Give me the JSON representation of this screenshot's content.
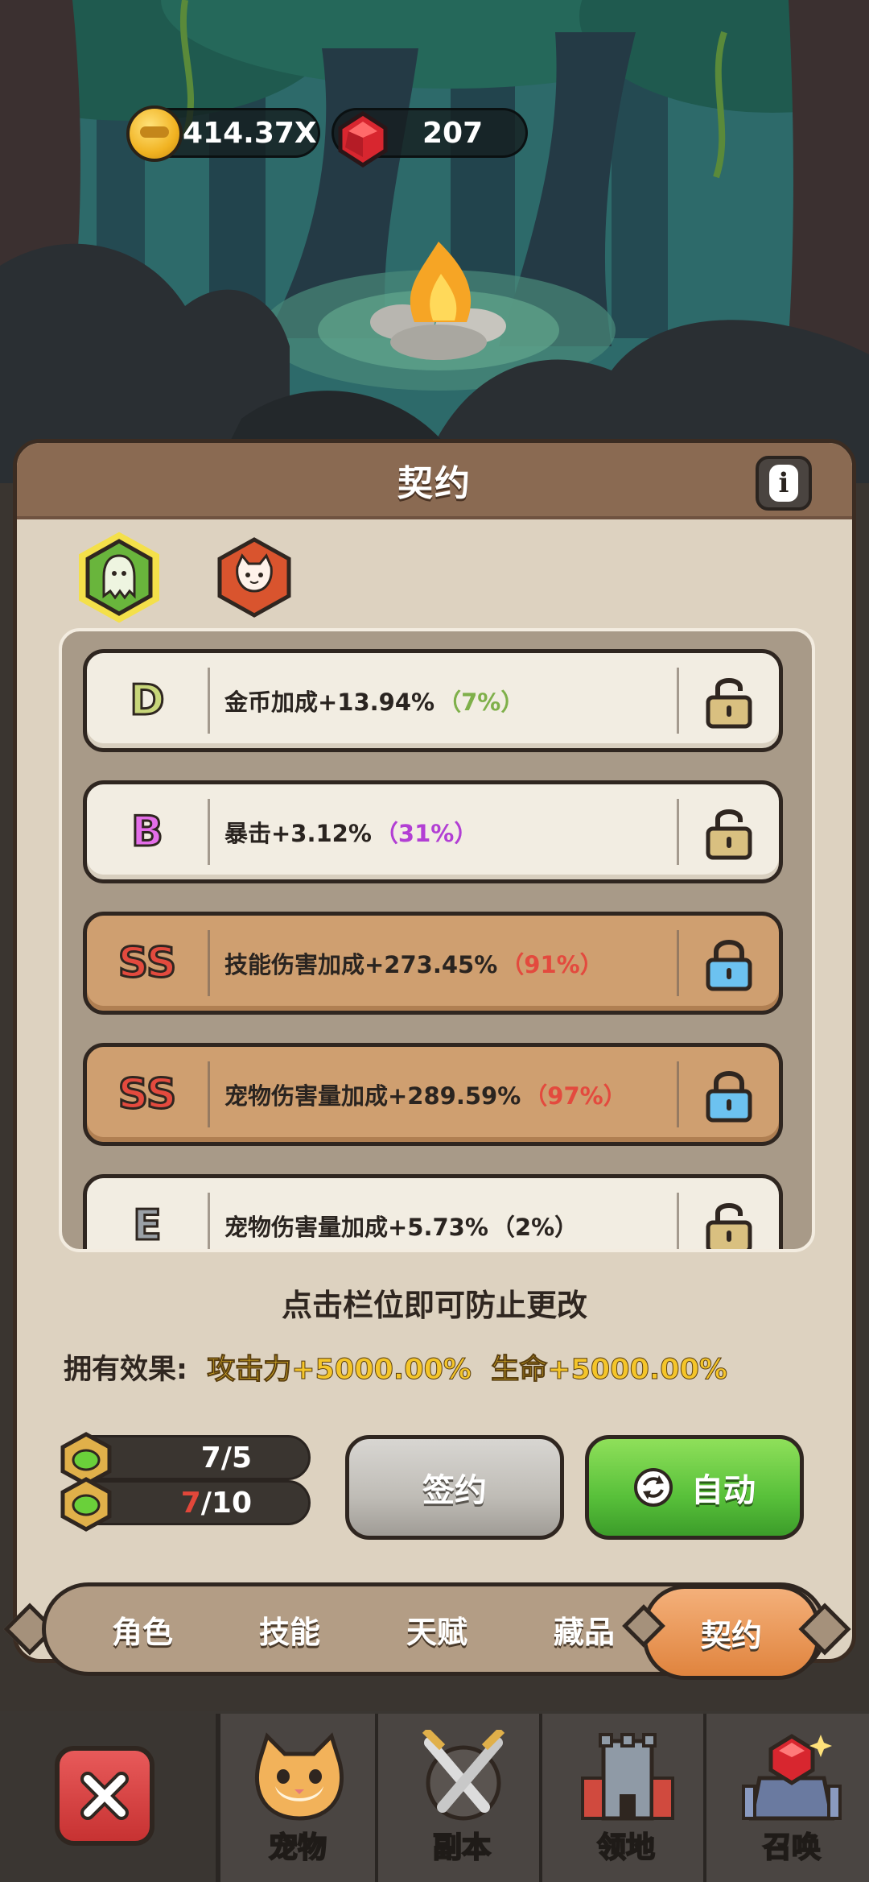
{
  "currency": {
    "gold": "414.37X",
    "gems": "207"
  },
  "panel": {
    "title": "契约",
    "info_icon": "info-icon"
  },
  "type_tabs": [
    {
      "name": "ghost-contract-tab",
      "icon": "ghost-icon",
      "selected": true
    },
    {
      "name": "cat-contract-tab",
      "icon": "cat-face-icon",
      "selected": false
    }
  ],
  "contracts": [
    {
      "grade": "D",
      "text": "金币加成+13.94%",
      "pct": "（7%）",
      "grade_color": "#c8d67a",
      "pct_color": "#7fb04a",
      "style": "light",
      "locked": false
    },
    {
      "grade": "B",
      "text": "暴击+3.12%",
      "pct": "（31%）",
      "grade_color": "#e46ee9",
      "pct_color": "#b23fd4",
      "style": "light",
      "locked": false
    },
    {
      "grade": "SS",
      "text": "技能伤害加成+273.45%",
      "pct": "（91%）",
      "grade_color": "#e34a3e",
      "pct_color": "#e34a3e",
      "style": "bronze",
      "locked": true
    },
    {
      "grade": "SS",
      "text": "宠物伤害量加成+289.59%",
      "pct": "（97%）",
      "grade_color": "#e34a3e",
      "pct_color": "#e34a3e",
      "style": "bronze",
      "locked": true
    },
    {
      "grade": "E",
      "text": "宠物伤害量加成+5.73%",
      "pct": "（2%）",
      "grade_color": "#9aa0a6",
      "pct_color": "#2a2420",
      "style": "light",
      "locked": false
    }
  ],
  "hint": "点击栏位即可防止更改",
  "effects": {
    "label": "拥有效果:",
    "attack": "攻击力+5000.00%",
    "life": "生命+5000.00%"
  },
  "counters": [
    {
      "current": "7",
      "max": " /5",
      "current_red": false
    },
    {
      "current": "7",
      "max": " /10",
      "current_red": true
    }
  ],
  "buttons": {
    "sign": "签约",
    "auto": "自动"
  },
  "tabs": [
    "角色",
    "技能",
    "天赋",
    "藏品",
    "契约"
  ],
  "active_tab": 4,
  "bottom_nav": [
    {
      "label": "宠物",
      "icon": "cat-icon"
    },
    {
      "label": "副本",
      "icon": "crossed-swords-icon"
    },
    {
      "label": "领地",
      "icon": "castle-icon"
    },
    {
      "label": "召唤",
      "icon": "summon-gem-icon"
    }
  ]
}
